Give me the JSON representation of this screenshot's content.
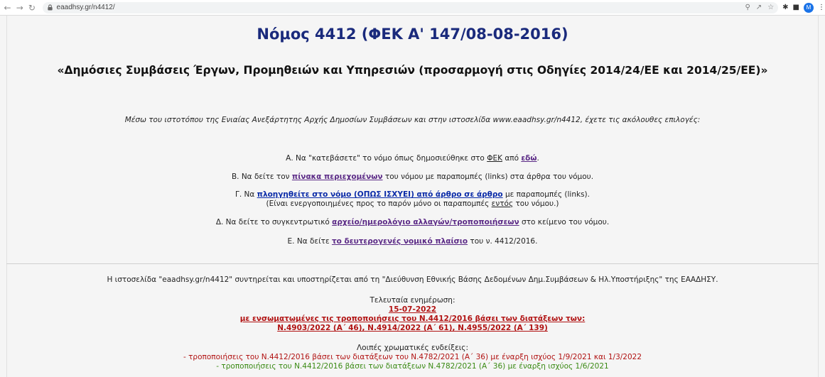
{
  "browser": {
    "url": "eaadhsy.gr/n4412/",
    "avatar_letter": "M"
  },
  "header": {
    "title": "Νόμος 4412 (ΦΕΚ Α' 147/08-08-2016)",
    "subtitle": "«Δημόσιες Συμβάσεις Έργων, Προμηθειών και Υπηρεσιών (προσαρμογή στις Οδηγίες 2014/24/ΕΕ και 2014/25/ΕΕ)»"
  },
  "intro": "Μέσω του ιστοτόπου της Ενιαίας Ανεξάρτητης Αρχής Δημοσίων Συμβάσεων και στην ιστοσελίδα www.eaadhsy.gr/n4412, έχετε τις ακόλουθες επιλογές:",
  "options": {
    "a": {
      "pre": "Α. Να \"κατεβάσετε\" το νόμο όπως δημοσιεύθηκε στο ",
      "fek": "ΦΕΚ",
      "mid": " από ",
      "link": "εδώ",
      "post": "."
    },
    "b": {
      "pre": "Β. Να δείτε τον ",
      "link": "πίνακα περιεχομένων",
      "post": " του νόμου με παραπομπές (links) στα άρθρα του νόμου."
    },
    "c": {
      "pre": "Γ. Να ",
      "link": "πλοηγηθείτε στο νόμο (ΟΠΩΣ ΙΣΧΥΕΙ) από άρθρο σε άρθρο",
      "post": " με παραπομπές (links).",
      "note_pre": "(Είναι ενεργοποιημένες προς το παρόν μόνο οι παραπομπές ",
      "note_u": "εντός",
      "note_post": " του νόμου.)"
    },
    "d": {
      "pre": "Δ. Να δείτε το συγκεντρωτικό ",
      "link": "αρχείο/ημερολόγιο αλλαγών/τροποποιήσεων",
      "post": " στο κείμενο του νόμου."
    },
    "e": {
      "pre": "Ε. Να δείτε ",
      "link": "το δευτερογενές νομικό πλαίσιο",
      "post": " του ν. 4412/2016."
    }
  },
  "footer": {
    "maintained": "Η ιστοσελίδα \"eaadhsy.gr/n4412\" συντηρείται και υποστηρίζεται από τη \"Διεύθυνση Εθνικής Βάσης Δεδομένων Δημ.Συμβάσεων & Ηλ.Υποστήριξης\" της ΕΑΑΔΗΣΥ.",
    "last_update_label": "Τελευταία ενημέρωση:",
    "last_update_date": "15-07-2022",
    "amendments_line1": "με ενσωματωμένες τις τροποποιήσεις του Ν.4412/2016 βάσει των διατάξεων των:",
    "amendments_line2": "Ν.4903/2022 (Α΄ 46), Ν.4914/2022 (Α΄ 61), Ν.4955/2022 (Α΄ 139)",
    "other_colors_label": "Λοιπές χρωματικές ενδείξεις:",
    "color_note_red": "- τροποποιήσεις του Ν.4412/2016 βάσει των διατάξεων του Ν.4782/2021 (Α΄ 36) με έναρξη ισχύος 1/9/2021 και 1/3/2022",
    "color_note_green": "- τροποποιήσεις του Ν.4412/2016 βάσει των διατάξεων Ν.4782/2021 (Α΄ 36) με έναρξη ισχύος 1/6/2021"
  },
  "colors": {
    "title": "#1a2a7c",
    "link": "#0a2ba8",
    "visited_link": "#5b2a86",
    "red": "#b11212",
    "green": "#3a8a14"
  }
}
